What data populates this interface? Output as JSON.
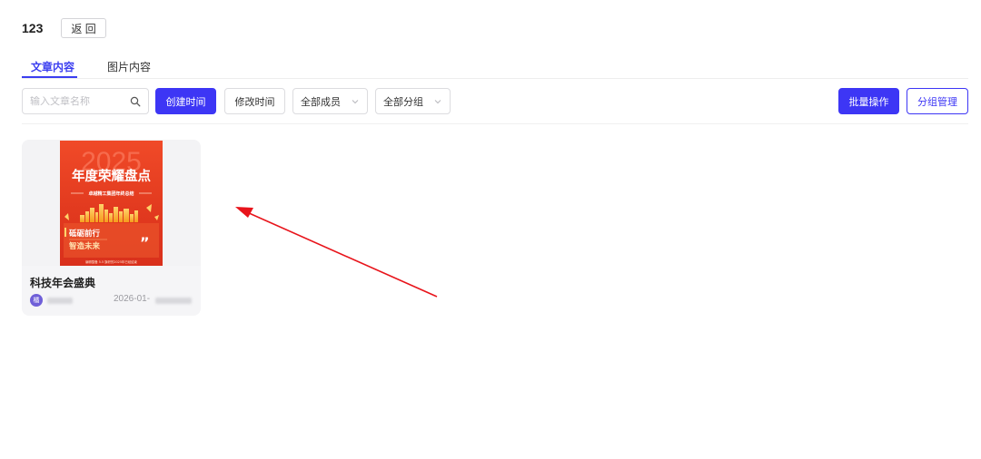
{
  "header": {
    "title": "123",
    "back_label": "返 回"
  },
  "tabs": [
    {
      "label": "文章内容",
      "active": true
    },
    {
      "label": "图片内容",
      "active": false
    }
  ],
  "toolbar": {
    "search_placeholder": "输入文章名称",
    "sort_created": "创建时间",
    "sort_modified": "修改时间",
    "member_filter": "全部成员",
    "group_filter": "全部分组",
    "batch_label": "批量操作",
    "group_manage_label": "分组管理"
  },
  "colors": {
    "accent": "#3d36f5",
    "poster_red": "#e23a1f",
    "avatar": "#6f5fd8",
    "arrow": "#e8141b"
  },
  "articles": [
    {
      "title": "科技年会盛典",
      "avatar_text": "橘",
      "date": "2026-01-",
      "poster": {
        "year": "2025",
        "headline": "年度荣耀盘点",
        "subtitle": "卓越精工集团年终总结",
        "slogan_line1": "砥砺前行",
        "slogan_line2": "智造未来",
        "quote_mark": "”",
        "footer": "编辑整备 5.5 旗帜的2025年已经结束"
      }
    }
  ]
}
